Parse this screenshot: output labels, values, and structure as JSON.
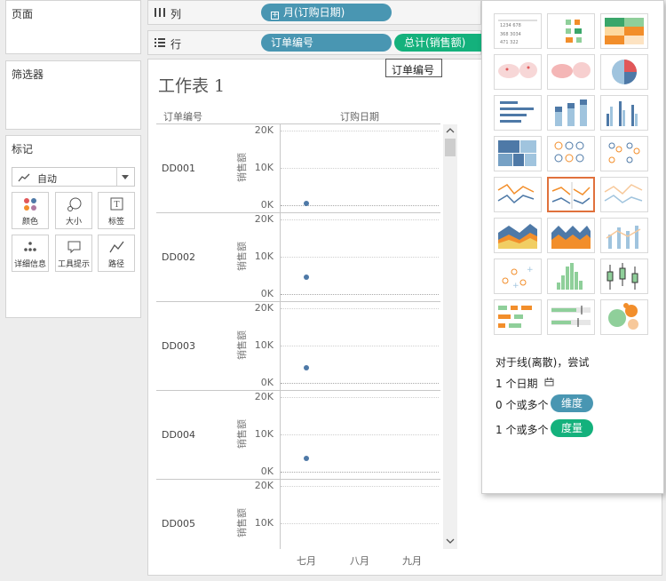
{
  "panels": {
    "pages": "页面",
    "filters": "筛选器",
    "marks": "标记"
  },
  "marks": {
    "type_label": "自动",
    "buttons": [
      {
        "label": "颜色",
        "icon": "color-dots-icon"
      },
      {
        "label": "大小",
        "icon": "size-icon"
      },
      {
        "label": "标签",
        "icon": "text-label-icon"
      },
      {
        "label": "详细信息",
        "icon": "detail-dots-icon"
      },
      {
        "label": "工具提示",
        "icon": "tooltip-icon"
      },
      {
        "label": "路径",
        "icon": "path-icon"
      }
    ]
  },
  "shelves": {
    "columns_label": "列",
    "rows_label": "行",
    "column_pill": "月(订购日期)",
    "row_pill_1": "订单编号",
    "row_pill_2": "总计(销售额)",
    "tooltip": "订单编号"
  },
  "sheet": {
    "title": "工作表 1",
    "row_header": "订单编号",
    "col_header": "订购日期",
    "x_ticks": [
      "七月",
      "八月",
      "九月"
    ],
    "y_axis_title": "销售额",
    "y_ticks": [
      "20K",
      "10K",
      "0K"
    ]
  },
  "chart_data": {
    "type": "line",
    "title": "工作表 1",
    "xlabel": "订购日期",
    "ylabel": "销售额",
    "x": [
      "七月",
      "八月",
      "九月"
    ],
    "ylim": [
      0,
      20000
    ],
    "rows": [
      {
        "name": "DD001",
        "points": [
          {
            "x": "七月",
            "y": 500
          }
        ]
      },
      {
        "name": "DD002",
        "points": [
          {
            "x": "七月",
            "y": 4500
          }
        ]
      },
      {
        "name": "DD003",
        "points": [
          {
            "x": "七月",
            "y": 4000
          }
        ]
      },
      {
        "name": "DD004",
        "points": [
          {
            "x": "七月",
            "y": 3500
          }
        ]
      },
      {
        "name": "DD005",
        "points": []
      }
    ]
  },
  "show_me": {
    "hint_title": "对于线(离散)，尝试",
    "hint_date": "1 个日期",
    "hint_dim_prefix": "0 个或多个",
    "hint_dim_pill": "维度",
    "hint_meas_prefix": "1 个或多个",
    "hint_meas_pill": "度量",
    "selected": "line-discrete",
    "colors": {
      "blue": "#4e79a7",
      "orange": "#f28e2b",
      "highlight": "#e0713c",
      "dimension_pill": "#4996b2",
      "measure_pill": "#14b17c"
    }
  }
}
